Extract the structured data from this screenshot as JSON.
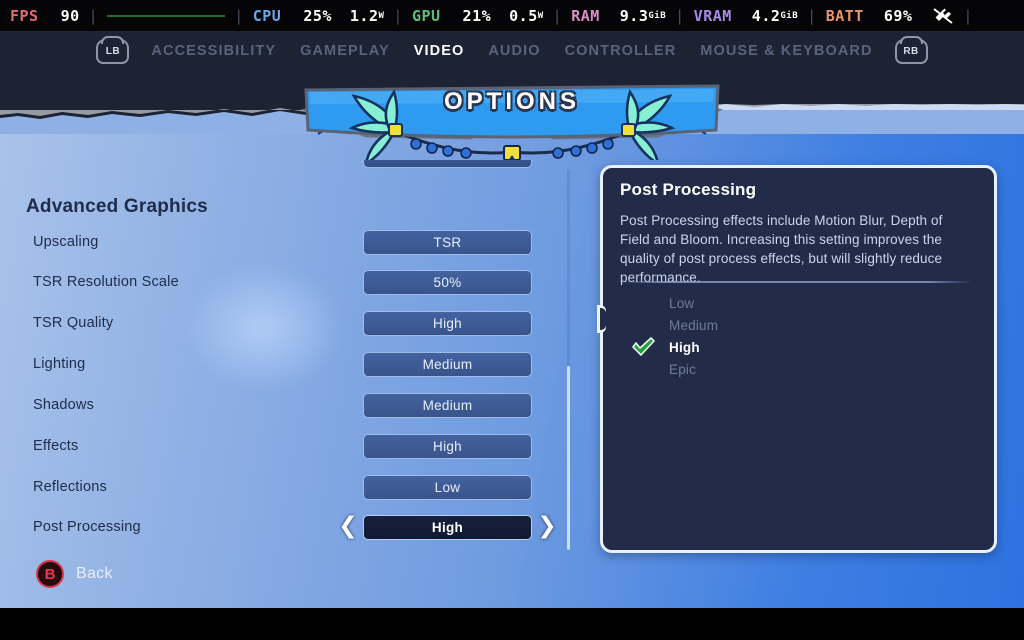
{
  "overlay": {
    "items": [
      {
        "label": "FPS",
        "label_color": "#e06b72",
        "value": "90",
        "unit": "",
        "graph": true
      },
      {
        "label": "CPU",
        "label_color": "#6aa6e8",
        "value": "25%",
        "value2": "1.2",
        "unit2": "W"
      },
      {
        "label": "GPU",
        "label_color": "#5bbf7a",
        "value": "21%",
        "value2": "0.5",
        "unit2": "W"
      },
      {
        "label": "RAM",
        "label_color": "#d98fc0",
        "value": "9.3",
        "unit": "GiB"
      },
      {
        "label": "VRAM",
        "label_color": "#a78ce8",
        "value": "4.2",
        "unit": "GiB"
      },
      {
        "label": "BATT",
        "label_color": "#e8956b",
        "value": "69%",
        "unit": ""
      }
    ],
    "plug_icon": "power-plug-icon",
    "separator": "|"
  },
  "tabs": {
    "left_bumper": "LB",
    "right_bumper": "RB",
    "items": [
      {
        "label": "ACCESSIBILITY",
        "active": false
      },
      {
        "label": "GAMEPLAY",
        "active": false
      },
      {
        "label": "VIDEO",
        "active": true
      },
      {
        "label": "AUDIO",
        "active": false
      },
      {
        "label": "CONTROLLER",
        "active": false
      },
      {
        "label": "MOUSE & KEYBOARD",
        "active": false
      }
    ]
  },
  "banner": {
    "title": "OPTIONS"
  },
  "settings": {
    "section_title": "Advanced Graphics",
    "rows": [
      {
        "label": "Upscaling",
        "value": "TSR",
        "selected": false
      },
      {
        "label": "TSR Resolution Scale",
        "value": "50%",
        "selected": false
      },
      {
        "label": "TSR Quality",
        "value": "High",
        "selected": false
      },
      {
        "label": "Lighting",
        "value": "Medium",
        "selected": false
      },
      {
        "label": "Shadows",
        "value": "Medium",
        "selected": false
      },
      {
        "label": "Effects",
        "value": "High",
        "selected": false
      },
      {
        "label": "Reflections",
        "value": "Low",
        "selected": false
      },
      {
        "label": "Post Processing",
        "value": "High",
        "selected": true
      }
    ],
    "arrow_left": "❮",
    "arrow_right": "❯"
  },
  "info": {
    "title": "Post Processing",
    "description": "Post Processing effects include Motion Blur, Depth of Field and Bloom. Increasing this setting improves the quality of post process effects, but will slightly reduce performance.",
    "options": [
      {
        "label": "Low",
        "chosen": false
      },
      {
        "label": "Medium",
        "chosen": false
      },
      {
        "label": "High",
        "chosen": true
      },
      {
        "label": "Epic",
        "chosen": false
      }
    ],
    "check_icon": "green-check-icon"
  },
  "footer": {
    "back_glyph": "B",
    "back_label": "Back"
  },
  "colors": {
    "accent_blue": "#3d7ee2",
    "panel_navy": "#222c49",
    "check_green": "#25a03f",
    "back_red": "#e8364c",
    "banner_blue": "#2e9bf0"
  }
}
